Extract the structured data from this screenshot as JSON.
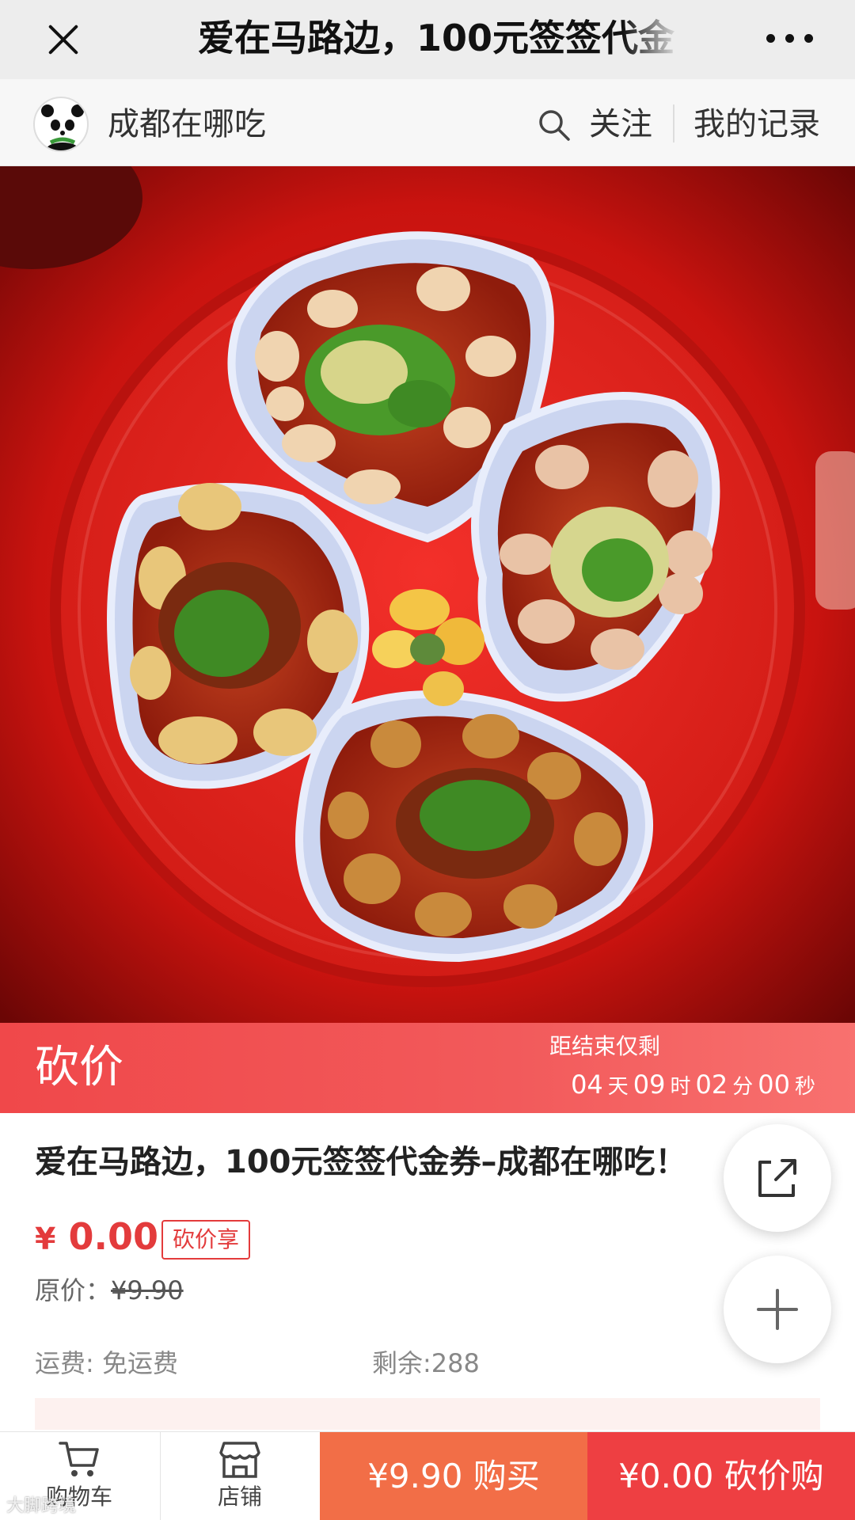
{
  "window": {
    "title": "爱在马路边，100元签签代金",
    "close_icon": "close-icon",
    "more_icon": "more-icon"
  },
  "shop": {
    "name": "成都在哪吃",
    "follow_label": "关注",
    "records_label": "我的记录"
  },
  "bargain": {
    "title": "砍价",
    "countdown_label": "距结束仅剩",
    "countdown": {
      "days": "04",
      "days_unit": "天",
      "hours": "09",
      "hours_unit": "时",
      "minutes": "02",
      "minutes_unit": "分",
      "seconds": "00",
      "seconds_unit": "秒"
    }
  },
  "product": {
    "title": "爱在马路边，100元签签代金券–成都在哪吃！",
    "price_symbol": "¥",
    "price": "0.00",
    "price_tag": "砍价享",
    "original_price_label": "原价：",
    "original_price": "¥9.90",
    "shipping": "运费: 免运费",
    "stock": "剩余:288"
  },
  "bottom_bar": {
    "cart_label": "购物车",
    "shop_label": "店铺",
    "buy_label": "¥9.90 购买",
    "bargain_buy_label": "¥0.00 砍价购"
  },
  "watermark": "大脚跨境",
  "colors": {
    "accent_red": "#e33b3c",
    "banner_red": "#f0484a",
    "buy_orange": "#f26e47",
    "bargain_red": "#ee3f42"
  }
}
